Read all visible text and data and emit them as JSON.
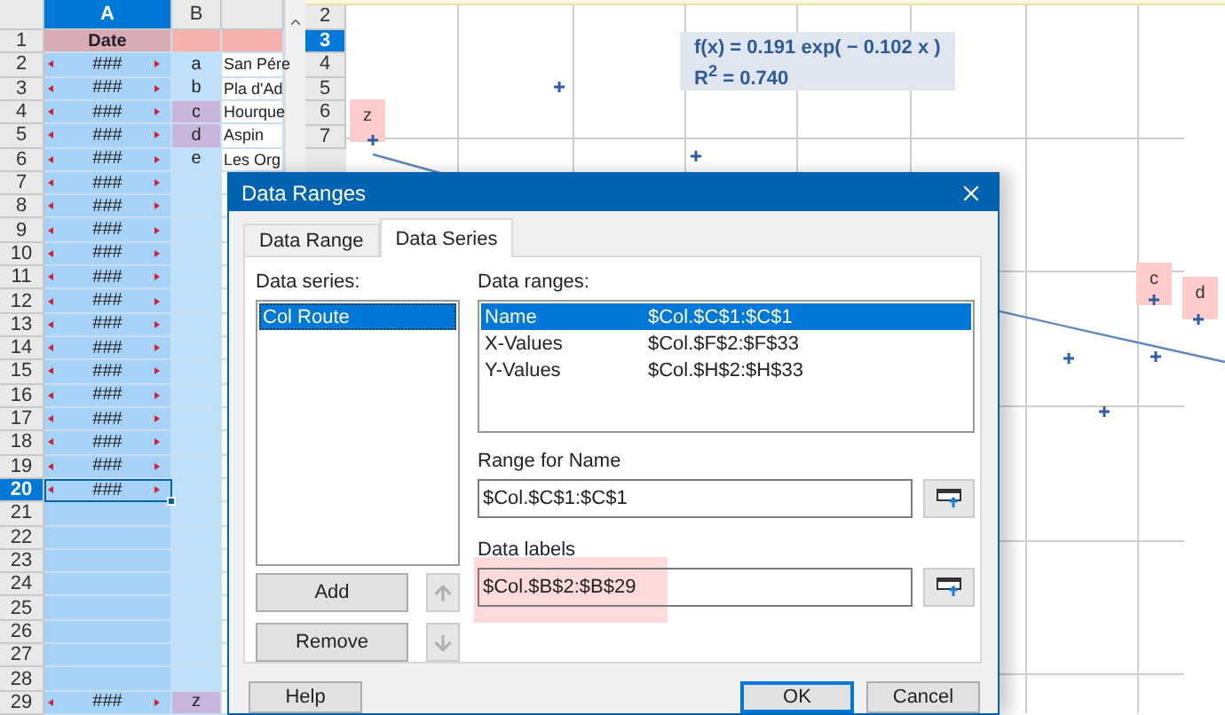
{
  "sheet": {
    "columns": [
      {
        "label": "A",
        "selected": true
      },
      {
        "label": "B",
        "selected": false
      }
    ],
    "rows": [
      {
        "number": "1",
        "selected": false,
        "kind": "header",
        "a": "Date"
      },
      {
        "number": "2",
        "selected": false,
        "kind": "data",
        "a": "###",
        "overflow": true,
        "b": "a",
        "b_marked": false,
        "c": "San Pére"
      },
      {
        "number": "3",
        "selected": false,
        "kind": "data",
        "a": "###",
        "overflow": true,
        "b": "b",
        "b_marked": false,
        "c": "Pla d'Ad"
      },
      {
        "number": "4",
        "selected": false,
        "kind": "data",
        "a": "###",
        "overflow": true,
        "b": "c",
        "b_marked": true,
        "c": "Hourque"
      },
      {
        "number": "5",
        "selected": false,
        "kind": "data",
        "a": "###",
        "overflow": true,
        "b": "d",
        "b_marked": true,
        "c": "Aspin"
      },
      {
        "number": "6",
        "selected": false,
        "kind": "data",
        "a": "###",
        "overflow": true,
        "b": "e",
        "b_marked": false,
        "c": "Les Org"
      },
      {
        "number": "7",
        "selected": false,
        "kind": "data",
        "a": "###",
        "overflow": true,
        "b_marked": false
      },
      {
        "number": "8",
        "selected": false,
        "kind": "data",
        "a": "###",
        "overflow": true,
        "b_marked": false
      },
      {
        "number": "9",
        "selected": false,
        "kind": "data",
        "a": "###",
        "overflow": true,
        "b_marked": false
      },
      {
        "number": "10",
        "selected": false,
        "kind": "data",
        "a": "###",
        "overflow": true,
        "b_marked": false
      },
      {
        "number": "11",
        "selected": false,
        "kind": "data",
        "a": "###",
        "overflow": true,
        "b_marked": false
      },
      {
        "number": "12",
        "selected": false,
        "kind": "data",
        "a": "###",
        "overflow": true,
        "b_marked": false
      },
      {
        "number": "13",
        "selected": false,
        "kind": "data",
        "a": "###",
        "overflow": true,
        "b_marked": false
      },
      {
        "number": "14",
        "selected": false,
        "kind": "data",
        "a": "###",
        "overflow": true,
        "b_marked": false
      },
      {
        "number": "15",
        "selected": false,
        "kind": "data",
        "a": "###",
        "overflow": true,
        "b_marked": false
      },
      {
        "number": "16",
        "selected": false,
        "kind": "data",
        "a": "###",
        "overflow": true,
        "b_marked": false
      },
      {
        "number": "17",
        "selected": false,
        "kind": "data",
        "a": "###",
        "overflow": true,
        "b_marked": false
      },
      {
        "number": "18",
        "selected": false,
        "kind": "data",
        "a": "###",
        "overflow": true,
        "b_marked": false
      },
      {
        "number": "19",
        "selected": false,
        "kind": "data",
        "a": "###",
        "overflow": true,
        "b_marked": false
      },
      {
        "number": "20",
        "selected": true,
        "kind": "data",
        "a": "###",
        "overflow": true,
        "b_marked": false
      },
      {
        "number": "21",
        "selected": false,
        "kind": "data",
        "overflow": false,
        "b_marked": false
      },
      {
        "number": "22",
        "selected": false,
        "kind": "data",
        "overflow": false,
        "b_marked": false
      },
      {
        "number": "23",
        "selected": false,
        "kind": "data",
        "overflow": false,
        "b_marked": false
      },
      {
        "number": "24",
        "selected": false,
        "kind": "data",
        "overflow": false,
        "b_marked": false
      },
      {
        "number": "25",
        "selected": false,
        "kind": "data",
        "overflow": false,
        "b_marked": false
      },
      {
        "number": "26",
        "selected": false,
        "kind": "data",
        "overflow": false,
        "b_marked": false
      },
      {
        "number": "27",
        "selected": false,
        "kind": "data",
        "overflow": false,
        "b_marked": false
      },
      {
        "number": "28",
        "selected": false,
        "kind": "data",
        "overflow": false,
        "b_marked": false
      },
      {
        "number": "29",
        "selected": false,
        "kind": "data",
        "a": "###",
        "overflow": true,
        "b": "z",
        "b_marked": true
      }
    ]
  },
  "chart_sheet": {
    "rows": [
      {
        "number": "2",
        "selected": false
      },
      {
        "number": "3",
        "selected": true
      },
      {
        "number": "4",
        "selected": false
      },
      {
        "number": "5",
        "selected": false
      },
      {
        "number": "6",
        "selected": false
      },
      {
        "number": "7",
        "selected": false
      }
    ],
    "equation": "f(x) = 0.191 exp( − 0.102 x )",
    "r_squared": "R$^{2}$ = 0.740",
    "point_labels": [
      {
        "label": "z",
        "highlighted": true
      },
      {
        "label": "c",
        "highlighted": true
      },
      {
        "label": "d",
        "highlighted": true
      }
    ]
  },
  "dialog": {
    "title": "Data Ranges",
    "tabs": [
      {
        "label": "Data Range",
        "selected": false
      },
      {
        "label": "Data Series",
        "selected": true
      }
    ],
    "series_label": "Data series:",
    "series": [
      {
        "label": "Col Route",
        "selected": true
      }
    ],
    "ranges_label": "Data ranges:",
    "ranges": [
      {
        "role": "Name",
        "range": "$Col.$C$1:$C$1",
        "selected": true
      },
      {
        "role": "X-Values",
        "range": "$Col.$F$2:$F$33",
        "selected": false
      },
      {
        "role": "Y-Values",
        "range": "$Col.$H$2:$H$33",
        "selected": false
      }
    ],
    "range_for_name": {
      "label": "Range for Name",
      "value": "$Col.$C$1:$C$1"
    },
    "data_labels": {
      "label": "Data labels",
      "value": "$Col.$B$2:$B$29",
      "highlighted": true
    },
    "add_button": "Add",
    "remove_button": "Remove",
    "move_up": {
      "disabled": true
    },
    "move_down": {
      "disabled": true
    },
    "footer_buttons": [
      {
        "label": "Help",
        "default": false
      },
      {
        "label": "OK",
        "default": true
      },
      {
        "label": "Cancel",
        "default": false
      }
    ]
  }
}
